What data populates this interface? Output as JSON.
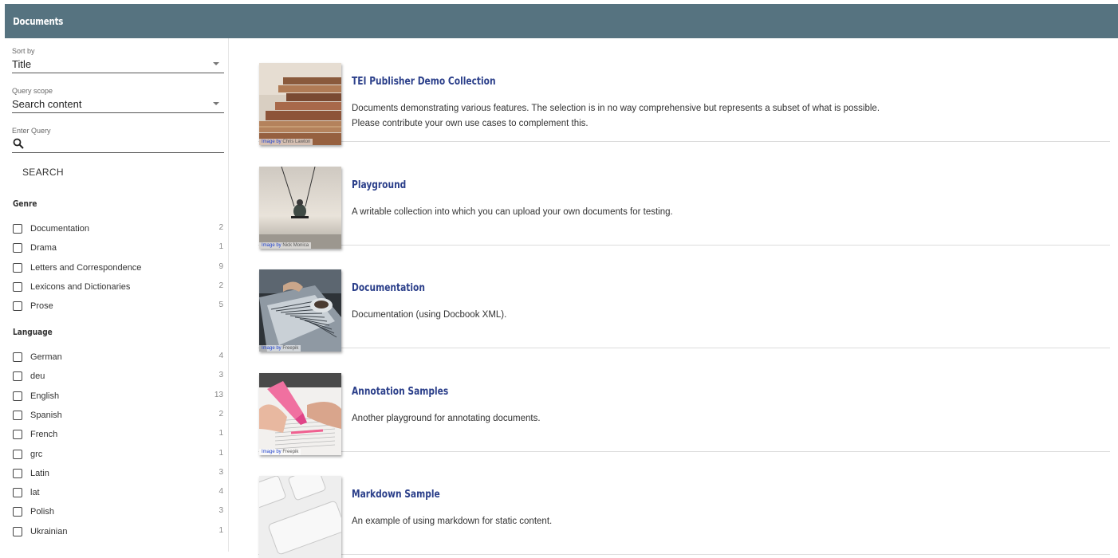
{
  "header": {
    "title": "Documents"
  },
  "sidebar": {
    "sort": {
      "label": "Sort by",
      "value": "Title"
    },
    "scope": {
      "label": "Query scope",
      "value": "Search content"
    },
    "query": {
      "label": "Enter Query",
      "value": ""
    },
    "search_button": "SEARCH",
    "genre": {
      "heading": "Genre",
      "items": [
        {
          "label": "Documentation",
          "count": "2"
        },
        {
          "label": "Drama",
          "count": "1"
        },
        {
          "label": "Letters and Correspondence",
          "count": "9"
        },
        {
          "label": "Lexicons and Dictionaries",
          "count": "2"
        },
        {
          "label": "Prose",
          "count": "5"
        }
      ]
    },
    "language": {
      "heading": "Language",
      "items": [
        {
          "label": "German",
          "count": "4"
        },
        {
          "label": "deu",
          "count": "3"
        },
        {
          "label": "English",
          "count": "13"
        },
        {
          "label": "Spanish",
          "count": "2"
        },
        {
          "label": "French",
          "count": "1"
        },
        {
          "label": "grc",
          "count": "1"
        },
        {
          "label": "Latin",
          "count": "3"
        },
        {
          "label": "lat",
          "count": "4"
        },
        {
          "label": "Polish",
          "count": "3"
        },
        {
          "label": "Ukrainian",
          "count": "1"
        }
      ]
    }
  },
  "collections": [
    {
      "title": "TEI Publisher Demo Collection",
      "desc1": "Documents demonstrating various features. The selection is in no way comprehensive but represents a subset of what is possible.",
      "desc2": "Please contribute your own use cases to complement this.",
      "credit_by": "Image by",
      "credit_name": "Chris Lawton"
    },
    {
      "title": "Playground",
      "desc1": "A writable collection into which you can upload your own documents for testing.",
      "desc2": "",
      "credit_by": "Image by",
      "credit_name": "Nick Monica"
    },
    {
      "title": "Documentation",
      "desc1": "Documentation (using Docbook XML).",
      "desc2": "",
      "credit_by": "Image by",
      "credit_name": "Freepik"
    },
    {
      "title": "Annotation Samples",
      "desc1": "Another playground for annotating documents.",
      "desc2": "",
      "credit_by": "Image by",
      "credit_name": "Freepik"
    },
    {
      "title": "Markdown Sample",
      "desc1": "An example of using markdown for static content.",
      "desc2": "",
      "credit_by": "",
      "credit_name": ""
    }
  ],
  "colors": {
    "header": "#567380",
    "title": "#2b3f8a"
  },
  "icons": {
    "search": "search-icon",
    "dropdown": "chevron-down-icon",
    "checkbox": "checkbox-icon"
  }
}
